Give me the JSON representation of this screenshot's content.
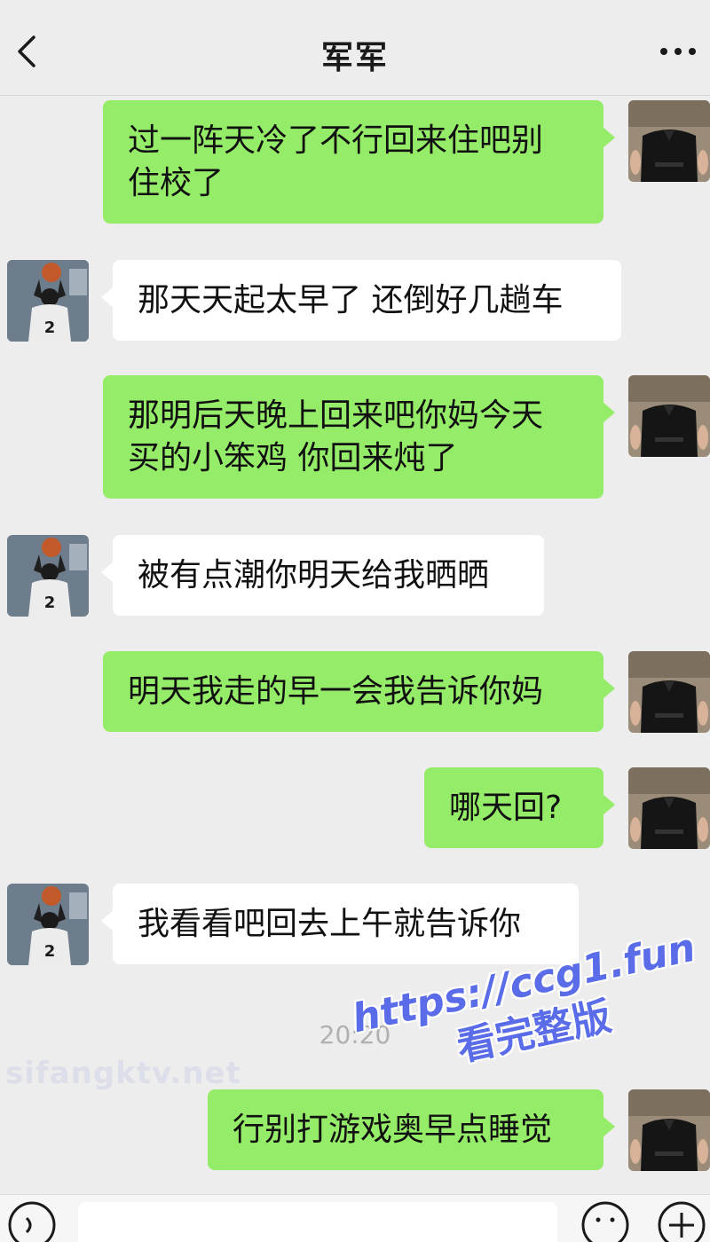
{
  "header": {
    "title": "军军",
    "back_icon": "chevron-left-icon",
    "more_icon": "more-dots-icon"
  },
  "messages": [
    {
      "side": "right",
      "text": "过一阵天冷了不行回来住吧别\n住校了"
    },
    {
      "side": "left",
      "text": "那天天起太早了 还倒好几趟车"
    },
    {
      "side": "right",
      "text": "那明后天晚上回来吧你妈今天\n买的小笨鸡 你回来炖了"
    },
    {
      "side": "left",
      "text": "被有点潮你明天给我晒晒"
    },
    {
      "side": "right",
      "text": "明天我走的早一会我告诉你妈"
    },
    {
      "side": "right",
      "text": "哪天回?"
    },
    {
      "side": "left",
      "text": "我看看吧回去上午就告诉你"
    },
    {
      "side": "right",
      "text": "行别打游戏奥早点睡觉"
    }
  ],
  "timestamp": "20:20",
  "watermarks": {
    "faint": "sifangktv.net",
    "blue_line1": "https://ccg1.fun",
    "blue_line2": "看完整版"
  },
  "colors": {
    "background": "#ededed",
    "sent_bubble": "#95ec69",
    "received_bubble": "#ffffff",
    "watermark_blue": "#5a6ce8"
  },
  "input_bar": {
    "voice_icon": "voice-icon",
    "emoji_icon": "emoji-icon",
    "plus_icon": "plus-icon"
  }
}
